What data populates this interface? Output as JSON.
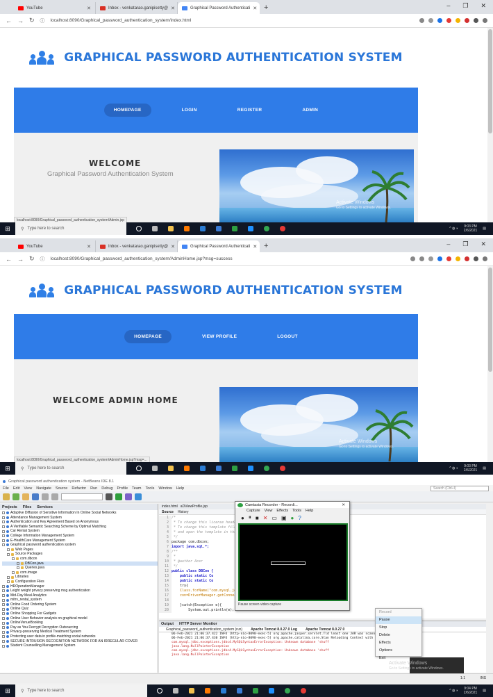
{
  "browser1": {
    "tabs": [
      {
        "label": "YouTube",
        "color": "#ff0000"
      },
      {
        "label": "Inbox - venkatarao.ganipisetty@",
        "color": "#d93025"
      },
      {
        "label": "Graphical Password Authenticati",
        "color": "#4285f4"
      }
    ],
    "url": "localhost:8090/Graphical_password_authentication_system/index.html",
    "status_url": "localhost:8090/Graphical_password_authentication_system/Admin.jsp"
  },
  "site1": {
    "title": "GRAPHICAL PASSWORD AUTHENTICATION SYSTEM",
    "nav": [
      "HOMEPAGE",
      "LOGIN",
      "REGISTER",
      "ADMIN"
    ],
    "welcome": "WELCOME",
    "subtitle": "Graphical Password Authentication System"
  },
  "browser2": {
    "tabs": [
      {
        "label": "YouTube",
        "color": "#ff0000"
      },
      {
        "label": "Inbox - venkatarao.ganipisetty@",
        "color": "#d93025"
      },
      {
        "label": "Graphical Password Authenticati",
        "color": "#4285f4"
      }
    ],
    "url": "localhost:8090/Graphical_password_authentication_system/AdminHome.jsp?msg=success",
    "status_url": "localhost:8090/Graphical_password_authentication_system/AdminHome.jsp?msg=..."
  },
  "site2": {
    "title": "GRAPHICAL PASSWORD AUTHENTICATION SYSTEM",
    "nav": [
      "HOMEPAGE",
      "VIEW PROFILE",
      "LOGOUT"
    ],
    "welcome": "WELCOME ADMIN HOME"
  },
  "activation": {
    "line1": "Activate Windows",
    "line2": "Go to Settings to activate Windows."
  },
  "taskbar": {
    "search": "Type here to search",
    "time1": "9:03 PM",
    "date1": "2/6/2021",
    "time2": "9:03 PM",
    "date2": "2/6/2021",
    "time3": "9:04 PM",
    "date3": "2/6/2021"
  },
  "netbeans": {
    "title": "Graphical password authentication system - NetBeans IDE 8.1",
    "menu": [
      "File",
      "Edit",
      "View",
      "Navigate",
      "Source",
      "Refactor",
      "Run",
      "Debug",
      "Profile",
      "Team",
      "Tools",
      "Window",
      "Help"
    ],
    "search_placeholder": "Search (Ctrl+I)",
    "panel_tabs": [
      "Projects",
      "Files",
      "Services"
    ],
    "projects": [
      "Adaptive Diffusion of Sensitive Information In Online Social Networks",
      "Attendance Management System",
      "Authentication and Key Agreement Based on Anonymous",
      "A Verifiable Semantic Searching Scheme by Optimal Matching",
      "Car Rental System",
      "College Information Management System",
      "E-HealthCare Management System",
      "Graphical password authentication system",
      "Web Pages",
      "Source Packages",
      "com.dbcon",
      "DBCon.java",
      "Queries.java",
      "com.image",
      "Libraries",
      "Configuration Files",
      "HROperationManager",
      "Leight weight privacy preserving msg authentication",
      "Mid-Day Meal Analytics",
      "mitrv_rental_system",
      "Online Food Ordering System",
      "Online Quiz",
      "Online Shopping For Gadgets",
      "Online User Behavior analysis on graphical model",
      "OnlineVenueBooking",
      "Pay as You Decrypt Decryption Outsourcing",
      "Privacy-preserving Medical Treatment System",
      "Protecting user data in profile-matching social networks",
      "SECURE INTRUSION RECOGNITION NETWORK FOR AN IRREGULAR COVER",
      "Student Counselling Management System"
    ],
    "editor_tabs": [
      "index.html",
      "aDViewProfile.jsp"
    ],
    "editor_sub": [
      "Source",
      "History"
    ],
    "code": [
      {
        "n": "1",
        "t": "/*",
        "c": "cm"
      },
      {
        "n": "2",
        "t": " * To change this license header, choose License Headers in Project Properties.",
        "c": "cm"
      },
      {
        "n": "3",
        "t": " * To change this template file, choose Tools | Templates",
        "c": "cm"
      },
      {
        "n": "4",
        "t": " * and open the template in the editor.",
        "c": "cm"
      },
      {
        "n": "5",
        "t": " */",
        "c": "cm"
      },
      {
        "n": "6",
        "t": "package com.dbcon;",
        "c": ""
      },
      {
        "n": "7",
        "t": "import java.sql.*;",
        "c": "kw"
      },
      {
        "n": "8",
        "t": "/**",
        "c": "cm"
      },
      {
        "n": "9",
        "t": " *",
        "c": "cm"
      },
      {
        "n": "10",
        "t": " * @author Acer",
        "c": "cm"
      },
      {
        "n": "11",
        "t": " */",
        "c": "cm"
      },
      {
        "n": "12",
        "t": "public class DBCon {",
        "c": "kw"
      },
      {
        "n": "13",
        "t": "    public static Co",
        "c": "kw"
      },
      {
        "n": "14",
        "t": "    public static Co",
        "c": "kw"
      },
      {
        "n": "15",
        "t": "    try{",
        "c": ""
      },
      {
        "n": "16",
        "t": "    Class.forName(\"com.mysql.jdbc.Driver\");",
        "c": "st"
      },
      {
        "n": "17",
        "t": "    con=DriverManager.getConnection(\"jdbc:mysql://localhost:3306/nhuffle\",\"root\",\"\");",
        "c": "st"
      },
      {
        "n": "18",
        "t": "",
        "c": ""
      },
      {
        "n": "19",
        "t": "    }catch(Exception e){",
        "c": ""
      },
      {
        "n": "20",
        "t": "        System.out.println(e);",
        "c": ""
      }
    ],
    "camtasia": {
      "title": "Camtasia Recorder - Recordi...",
      "menu": [
        "Capture",
        "View",
        "Effects",
        "Tools",
        "Help"
      ],
      "caption": "Pause screen video capture"
    },
    "output_tabs": [
      "Output",
      "HTTP Server Monitor"
    ],
    "output_sub": [
      "Graphical_password_authentication_system (run)",
      "Apache Tomcat 8.0.27.0 Log",
      "Apache Tomcat 8.0.27.0"
    ],
    "output_lines": [
      "06-Feb-2021 21:06:37.422 INFO [http-nio-8090-exec-5] org.apache.jasper.servlet.Tld  least one JAR was scanne",
      "06-Feb-2021 21:06:37.430 INFO [http-nio-8090-exec-5] org.apache.catalina.core.Stan  Reloading Context with na",
      "com.mysql.jdbc.exceptions.jdbc4.MySQLSyntaxErrorException: Unknown database 'shuff",
      "java.lang.NullPointerException",
      "com.mysql.jdbc.exceptions.jdbc4.MySQLSyntaxErrorException: Unknown database 'shuff",
      "java.lang.NullPointerException"
    ],
    "context_menu": [
      "Record",
      "Pause",
      "Stop",
      "Delete",
      "Effects",
      "Options",
      "Exit"
    ],
    "cursor_pos": "1:1",
    "ins": "INS"
  }
}
